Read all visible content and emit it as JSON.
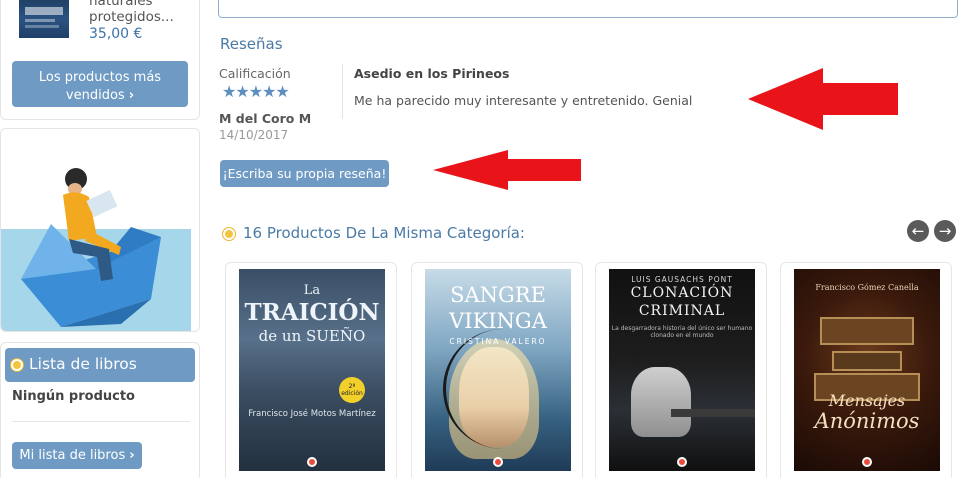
{
  "sidebar": {
    "featured": {
      "name": "naturales protegidos...",
      "price": "35,00 €"
    },
    "best_sellers_button": "Los productos más vendidos",
    "book_list": {
      "title": "Lista de libros",
      "empty_text": "Ningún producto",
      "button": "Mi lista de libros"
    }
  },
  "reviews": {
    "title": "Reseñas",
    "rating_label": "Calificación",
    "stars": "★★★★★",
    "rating": 5,
    "reviewer": "M del Coro M",
    "date": "14/10/2017",
    "review_title": "Asedio en los Pirineos",
    "review_text": "Me ha parecido muy interesante y entretenido. Genial",
    "write_button": "¡Escriba su propia reseña!"
  },
  "category": {
    "title": "16 Productos De La Misma Categoría:",
    "prev_icon": "arrow-left-icon",
    "next_icon": "arrow-right-icon",
    "products": [
      {
        "cover_line1": "La",
        "cover_line2": "TRAICIÓN",
        "cover_line3": "de un SUEÑO",
        "author": "Francisco José Motos Martínez",
        "badge": "2ª edición"
      },
      {
        "cover_line1": "SANGRE",
        "cover_line2": "VIKINGA",
        "author": "CRISTINA VALERO"
      },
      {
        "author": "LUIS GAUSACHS PONT",
        "cover_line1": "CLONACIÓN",
        "cover_line2": "CRIMINAL",
        "subtitle": "La desgarradora historia del único ser humano clonado en el mundo"
      },
      {
        "author": "Francisco Gómez Canella",
        "cover_line1": "Mensajes",
        "cover_line2": "Anónimos"
      }
    ]
  },
  "colors": {
    "button_blue": "#6f9ac3",
    "heading_blue": "#4a7aa6",
    "annotation_red": "#e8141a",
    "bullet_yellow": "#f3c53e"
  }
}
